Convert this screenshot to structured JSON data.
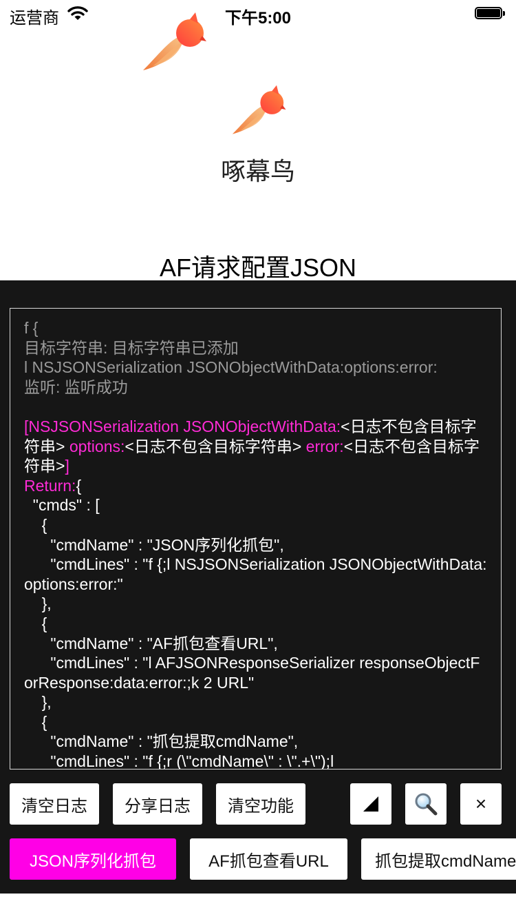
{
  "status_bar": {
    "carrier": "运营商",
    "time": "下午5:00"
  },
  "app": {
    "title": "啄幕鸟"
  },
  "page": {
    "heading": "AF请求配置JSON"
  },
  "log": {
    "header_lines": [
      "f {",
      "目标字符串: 目标字符串已添加",
      "l NSJSONSerialization JSONObjectWithData:options:error:",
      "监听: 监听成功"
    ],
    "call": {
      "open_bracket": "[NSJSONSerialization JSONObjectWithData:",
      "arg1": "<日志不包含目标字符串>",
      "options_label": " options:",
      "arg2": "<日志不包含目标字符串>",
      "error_label": " error:",
      "arg3": "<日志不包含目标字符串>",
      "close_bracket": "]"
    },
    "return_label": "Return:",
    "return_open": "{",
    "json_lines": [
      "  \"cmds\" : [",
      "    {",
      "      \"cmdName\" : \"JSON序列化抓包\",",
      "      \"cmdLines\" : \"f {;l NSJSONSerialization JSONObjectWithData:options:error:\"",
      "    },",
      "    {",
      "      \"cmdName\" : \"AF抓包查看URL\",",
      "      \"cmdLines\" : \"l AFJSONResponseSerializer responseObjectForResponse:data:error:;k 2 URL\"",
      "    },",
      "    {",
      "      \"cmdName\" : \"抓包提取cmdName\",",
      "      \"cmdLines\" : \"f {;r (\\\"cmdName\\\" : \\\".+\\\");l"
    ]
  },
  "toolbar": {
    "clear_log": "清空日志",
    "share_log": "分享日志",
    "clear_functions": "清空功能",
    "collapse_icon": "corner-triangle-icon",
    "search_icon": "magnifier-icon",
    "close_label": "×"
  },
  "commands": [
    {
      "label": "JSON序列化抓包",
      "active": true
    },
    {
      "label": "AF抓包查看URL",
      "active": false
    },
    {
      "label": "抓包提取cmdName",
      "active": false
    }
  ],
  "colors": {
    "console_bg": "#161616",
    "highlight": "#ff2bd6",
    "active_button": "#ff00e6",
    "muted_text": "#9a9a9a"
  }
}
